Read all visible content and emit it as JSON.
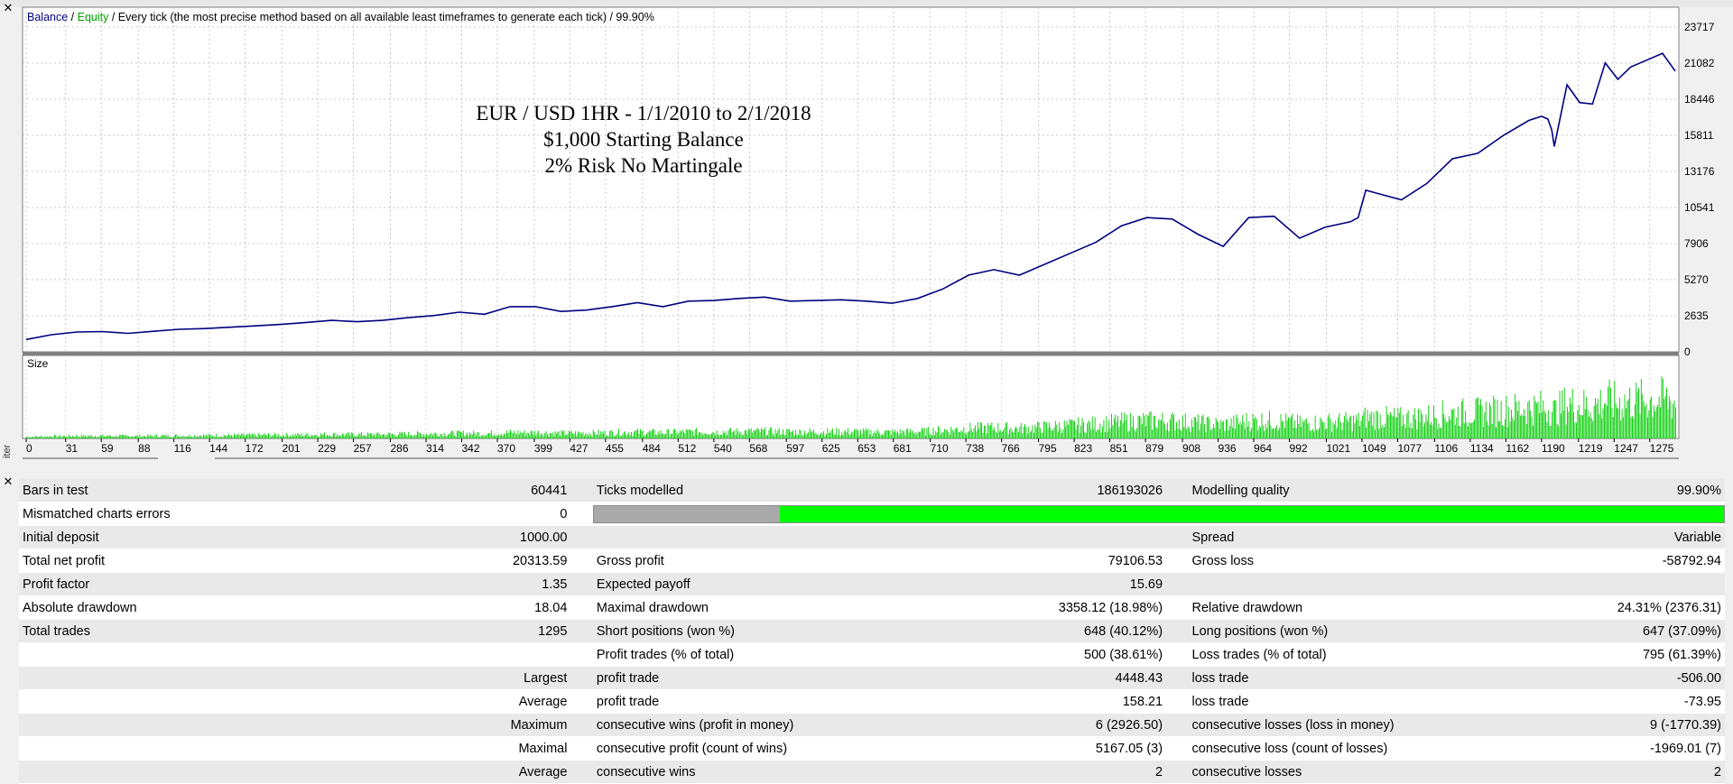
{
  "header": {
    "balance_label": "Balance",
    "separator": " / ",
    "equity_label": "Equity",
    "description": " / Every tick (the most precise method based on all available least timeframes to generate each tick) / 99.90%"
  },
  "annotation": {
    "line1": "EUR / USD 1HR - 1/1/2010 to 2/1/2018",
    "line2": "$1,000 Starting Balance",
    "line3": "2% Risk No Martingale"
  },
  "side_label": "iter",
  "size_panel": {
    "label": "Size"
  },
  "icons": {
    "close": "close-icon"
  },
  "colors": {
    "balance": "#000080",
    "equity": "#00a000",
    "volume": "#00cc00",
    "quality_bar": "#00ff00"
  },
  "chart_data": {
    "type": "line",
    "x_ticks": [
      "0",
      "31",
      "59",
      "88",
      "116",
      "144",
      "172",
      "201",
      "229",
      "257",
      "286",
      "314",
      "342",
      "370",
      "399",
      "427",
      "455",
      "484",
      "512",
      "540",
      "568",
      "597",
      "625",
      "653",
      "681",
      "710",
      "738",
      "766",
      "795",
      "823",
      "851",
      "879",
      "908",
      "936",
      "964",
      "992",
      "1021",
      "1049",
      "1077",
      "1106",
      "1134",
      "1162",
      "1190",
      "1219",
      "1247",
      "1275"
    ],
    "y_ticks": [
      "23717",
      "21082",
      "18446",
      "15811",
      "13176",
      "10541",
      "7906",
      "5270",
      "2635",
      "0"
    ],
    "xlim": [
      0,
      1295
    ],
    "ylim": [
      0,
      23717
    ],
    "series": [
      {
        "name": "Balance",
        "x": [
          0,
          20,
          40,
          60,
          80,
          100,
          120,
          140,
          160,
          180,
          200,
          220,
          240,
          260,
          280,
          300,
          320,
          340,
          360,
          380,
          400,
          420,
          440,
          460,
          480,
          500,
          520,
          540,
          560,
          580,
          600,
          620,
          640,
          660,
          680,
          700,
          720,
          740,
          760,
          780,
          800,
          820,
          840,
          860,
          880,
          900,
          920,
          940,
          960,
          980,
          1000,
          1020,
          1040,
          1046,
          1052,
          1080,
          1100,
          1120,
          1140,
          1160,
          1180,
          1190,
          1195,
          1198,
          1200,
          1210,
          1220,
          1230,
          1240,
          1250,
          1260,
          1275,
          1285,
          1295
        ],
        "y": [
          900,
          1250,
          1450,
          1480,
          1350,
          1500,
          1650,
          1700,
          1800,
          1900,
          2000,
          2150,
          2300,
          2200,
          2300,
          2500,
          2650,
          2900,
          2750,
          3300,
          3300,
          2950,
          3050,
          3300,
          3600,
          3300,
          3700,
          3750,
          3900,
          4000,
          3700,
          3750,
          3800,
          3700,
          3550,
          3900,
          4600,
          5600,
          6000,
          5600,
          6400,
          7200,
          8000,
          9200,
          9800,
          9700,
          8600,
          7700,
          9800,
          9900,
          8300,
          9100,
          9500,
          9800,
          11800,
          11100,
          12300,
          14100,
          14500,
          15800,
          16900,
          17200,
          17000,
          16200,
          15000,
          19500,
          18200,
          18100,
          21100,
          19900,
          20800,
          21400,
          21800,
          20500
        ]
      }
    ],
    "size_panel": {
      "label": "Size"
    }
  },
  "stats": {
    "rows": [
      [
        "Bars in test",
        "60441",
        "Ticks modelled",
        "186193026",
        "Modelling quality",
        "99.90%"
      ],
      [
        "Mismatched charts errors",
        "0",
        "BAR",
        "",
        "",
        ""
      ],
      [
        "Initial deposit",
        "1000.00",
        "",
        "",
        "Spread",
        "Variable"
      ],
      [
        "Total net profit",
        "20313.59",
        "Gross profit",
        "79106.53",
        "Gross loss",
        "-58792.94"
      ],
      [
        "Profit factor",
        "1.35",
        "Expected payoff",
        "15.69",
        "",
        ""
      ],
      [
        "Absolute drawdown",
        "18.04",
        "Maximal drawdown",
        "3358.12 (18.98%)",
        "Relative drawdown",
        "24.31% (2376.31)"
      ],
      [
        "Total trades",
        "1295",
        "Short positions (won %)",
        "648 (40.12%)",
        "Long positions (won %)",
        "647 (37.09%)"
      ],
      [
        "",
        "",
        "Profit trades (% of total)",
        "500 (38.61%)",
        "Loss trades (% of total)",
        "795 (61.39%)"
      ],
      [
        "",
        "Largest",
        "profit trade",
        "4448.43",
        "loss trade",
        "-506.00"
      ],
      [
        "",
        "Average",
        "profit trade",
        "158.21",
        "loss trade",
        "-73.95"
      ],
      [
        "",
        "Maximum",
        "consecutive wins (profit in money)",
        "6 (2926.50)",
        "consecutive losses (loss in money)",
        "9 (-1770.39)"
      ],
      [
        "",
        "Maximal",
        "consecutive profit (count of wins)",
        "5167.05 (3)",
        "consecutive loss (count of losses)",
        "-1969.01 (7)"
      ],
      [
        "",
        "Average",
        "consecutive wins",
        "2",
        "consecutive losses",
        "2"
      ]
    ],
    "quality_fraction": 0.165
  }
}
